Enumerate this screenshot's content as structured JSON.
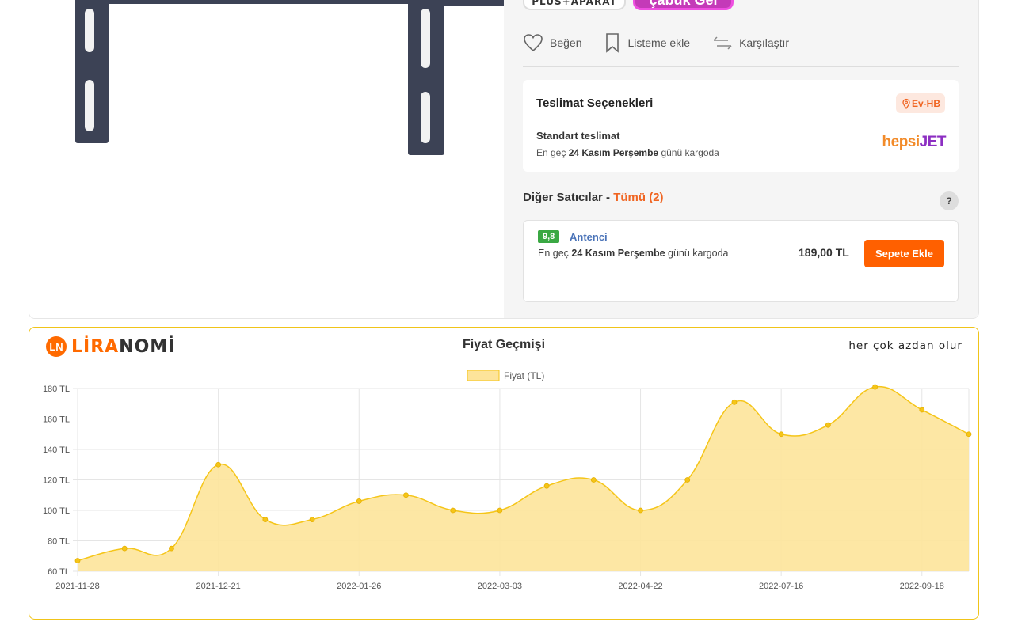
{
  "badges": {
    "plus": "PLUS+APARAT",
    "cabuk": "çabuk Gel"
  },
  "actions": {
    "like": "Beğen",
    "list": "Listeme ekle",
    "compare": "Karşılaştır"
  },
  "delivery": {
    "title": "Teslimat Seçenekleri",
    "location_badge": "Ev-HB",
    "standard": "Standart teslimat",
    "prefix": "En geç",
    "date": "24 Kasım Perşembe",
    "suffix": "günü kargoda",
    "carrier_a": "hepsi",
    "carrier_b": "JET"
  },
  "other_sellers": {
    "title": "Diğer Satıcılar - ",
    "all_link": "Tümü (2)",
    "help": "?"
  },
  "seller": {
    "rating": "9,8",
    "name": "Antenci",
    "prefix": "En geç",
    "date": "24 Kasım Perşembe",
    "suffix": "günü kargoda",
    "price": "189,00 TL",
    "button": "Sepete Ekle"
  },
  "liranomi": {
    "logo_a": "LİRA",
    "logo_b": "NOMİ",
    "logo_icon": "LN",
    "slogan": "her çok azdan olur"
  },
  "colors": {
    "accent": "#ff6000",
    "chart_fill": "#fde49a",
    "chart_line": "#f5c518",
    "rating_green": "#3aa843",
    "seller_blue": "#4a73b8"
  },
  "chart_data": {
    "type": "area",
    "title": "Fiyat Geçmişi",
    "legend": "Fiyat (TL)",
    "legend_position": "top-center",
    "ylim": [
      60,
      180
    ],
    "yticks": [
      "180 TL",
      "160 TL",
      "140 TL",
      "120 TL",
      "100 TL",
      "80 TL",
      "60 TL"
    ],
    "xticks": [
      "2021-11-28",
      "2021-12-21",
      "2022-01-26",
      "2022-03-03",
      "2022-04-22",
      "2022-07-16",
      "2022-09-18"
    ],
    "grid": true,
    "series": [
      {
        "name": "Fiyat (TL)",
        "values": [
          67,
          75,
          75,
          130,
          94,
          94,
          106,
          110,
          100,
          100,
          116,
          120,
          100,
          120,
          171,
          150,
          156,
          181,
          166,
          150
        ]
      }
    ]
  }
}
